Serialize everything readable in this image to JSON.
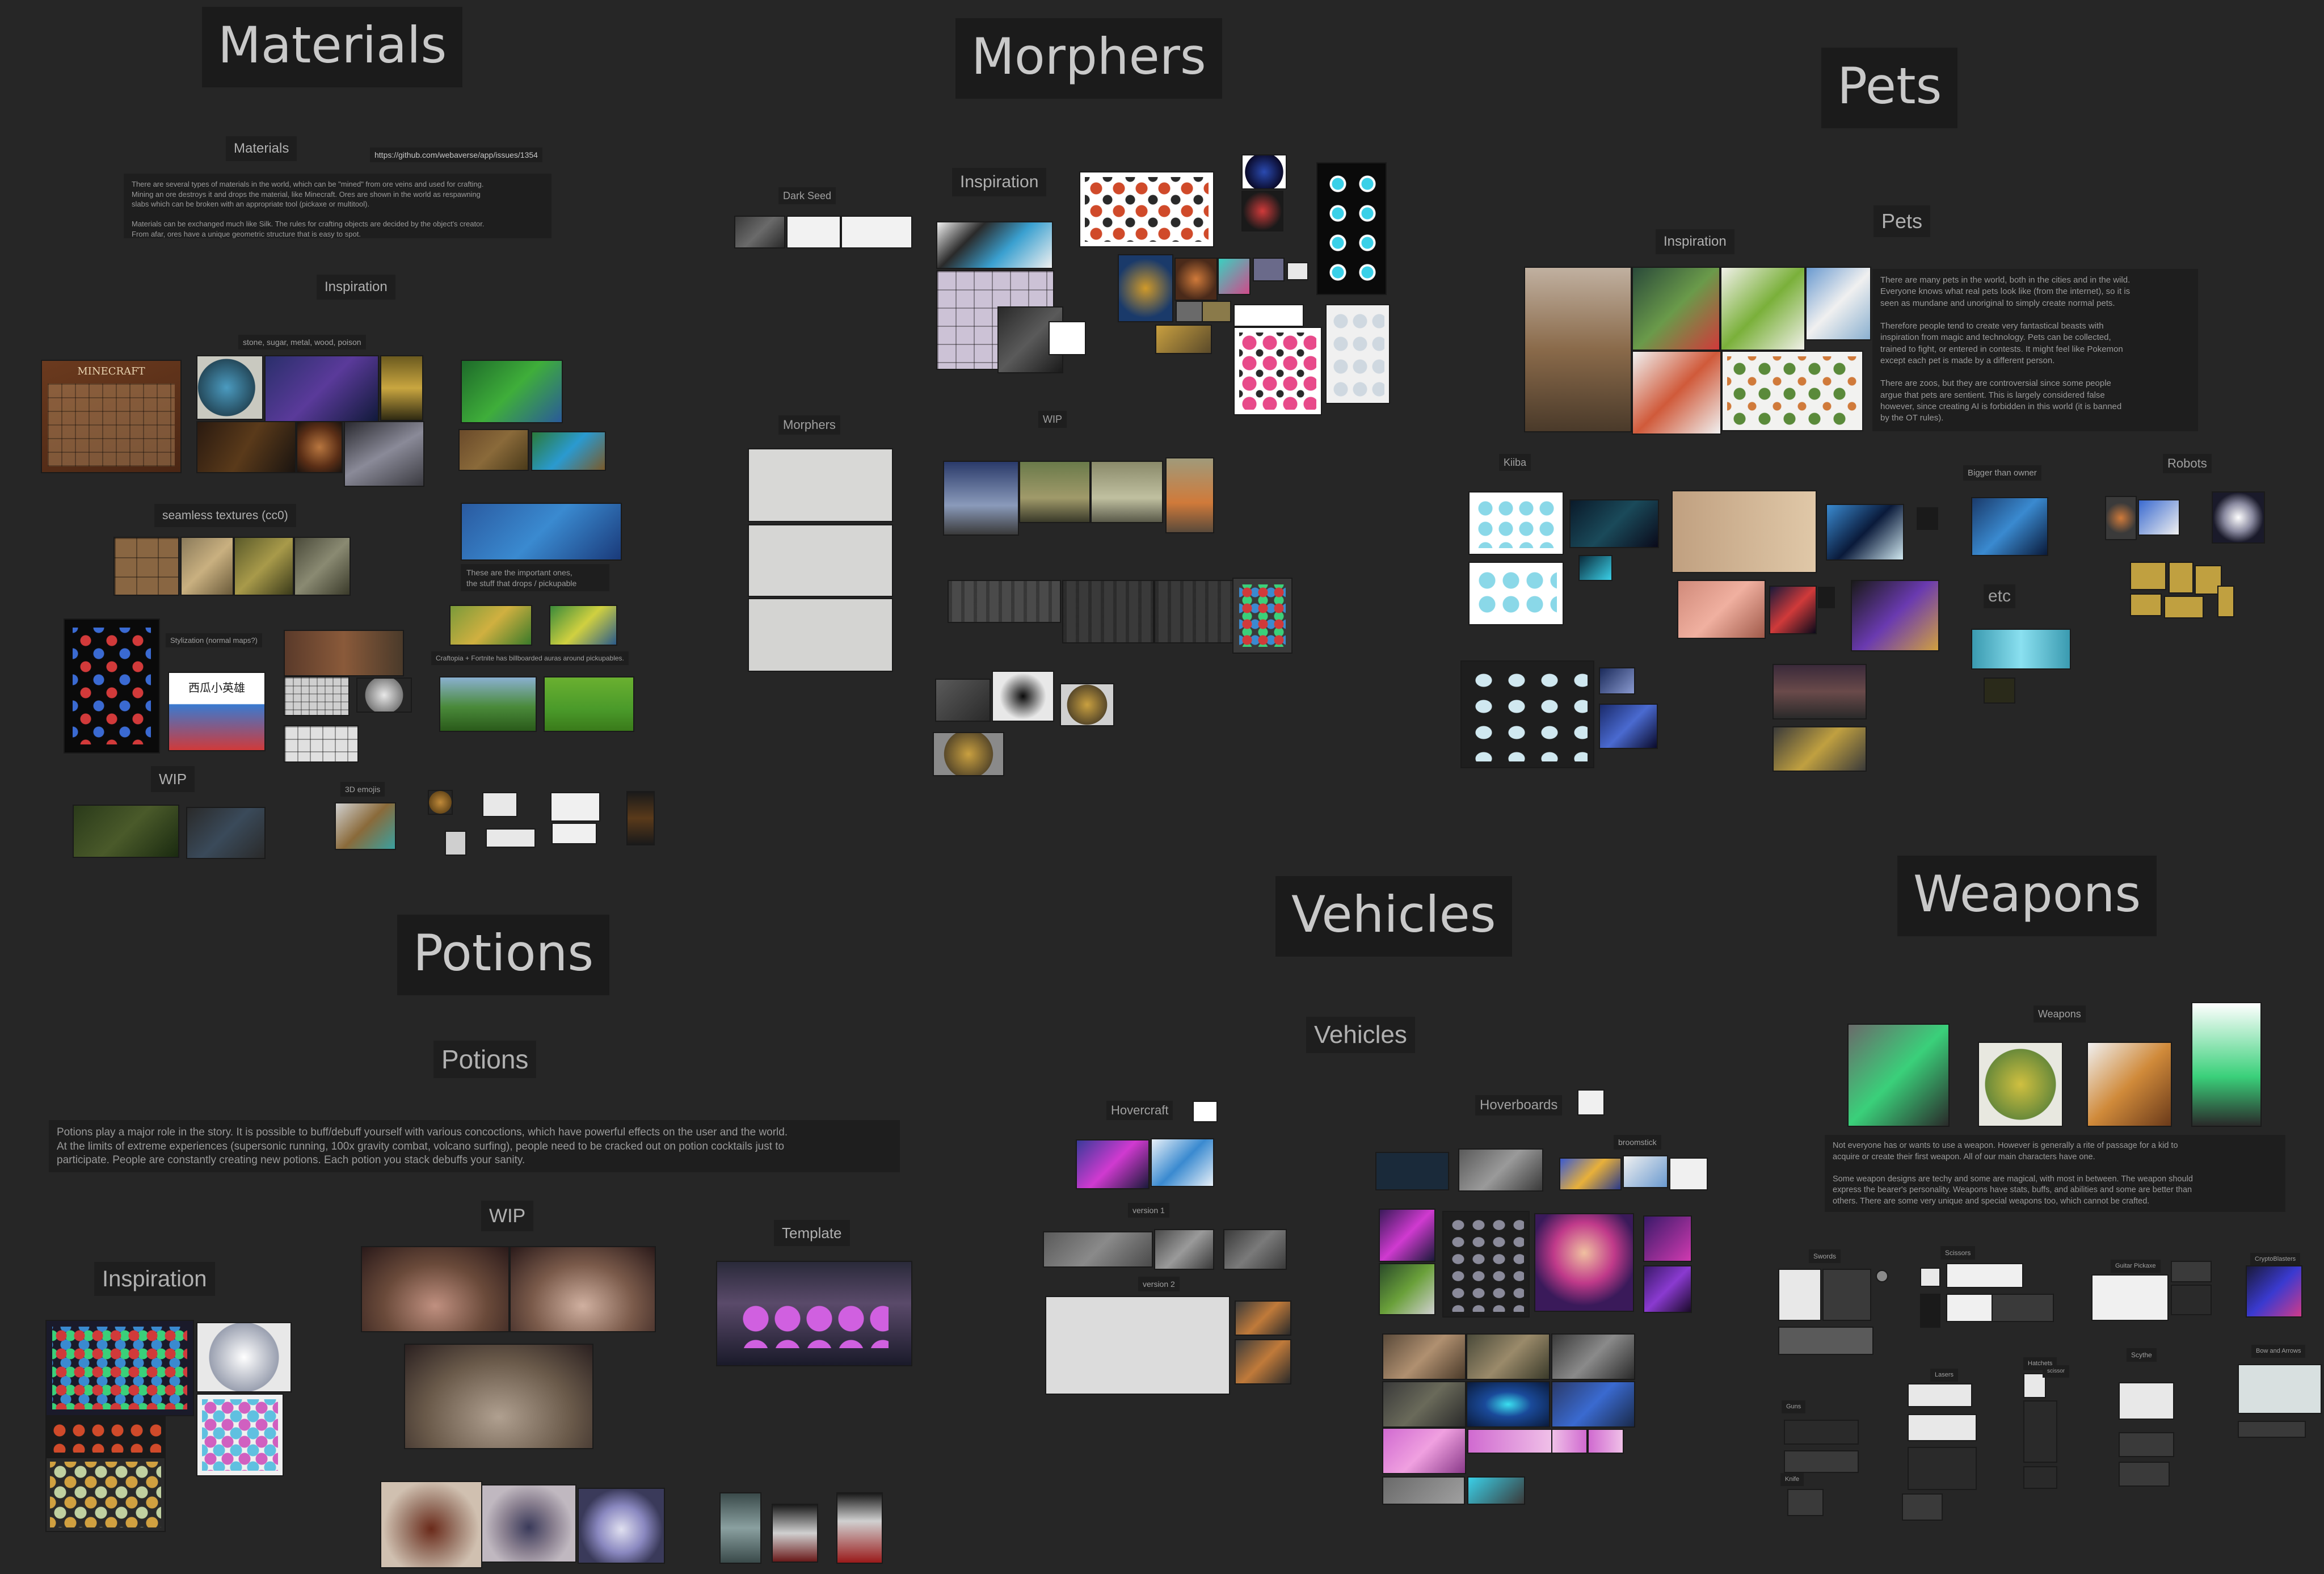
{
  "sections": {
    "materials": {
      "title": "Materials",
      "subtitle": "Materials",
      "link": "https://github.com/webaverse/app/issues/1354",
      "description": "There are several types of materials in the world, which can be \"mined\" from ore veins and used for crafting.\nMining an ore destroys it and drops the material, like Minecraft. Ores are shown in the world as respawning\nslabs which can be broken with an appropriate tool (pickaxe or multitool).\n\nMaterials can be exchanged much like Silk. The rules for crafting objects are decided by the object's creator.\nFrom afar, ores have a unique geometric structure that is easy to spot.",
      "inspiration": "Inspiration",
      "inspiration_caption": "stone, sugar, metal, wood, poison",
      "dark_seed": "Dark Seed",
      "seamless": "seamless textures (cc0)",
      "stylization": "Stylization (normal maps?)",
      "important": "These are the important ones,\nthe stuff that drops / pickupable",
      "craftopia": "Craftopia + Fortnite has billboarded auras around pickupables.",
      "wip": "WIP",
      "emojis": "3D emojis",
      "minecraft_caption": "MINECRAFT",
      "calligraphy": "西瓜小英雄"
    },
    "morphers": {
      "title": "Morphers",
      "inspiration": "Inspiration",
      "wip": "WIP",
      "morphers_label": "Morphers"
    },
    "pets": {
      "title": "Pets",
      "subtitle": "Pets",
      "inspiration": "Inspiration",
      "description": "There are many pets in the world, both in the cities and in the wild.\nEveryone knows what real pets look like (from the internet), so it is\nseen as mundane and unoriginal to simply create normal pets.\n\nTherefore people tend to create very fantastical beasts with\ninspiration from magic and technology. Pets can be collected,\ntrained to fight, or entered in contests. It might feel like Pokemon\nexcept each pet is made by a different person.\n\nThere are zoos, but they are controversial since some people\nargue that pets are sentient. This is largely considered false\nhowever, since creating AI is forbidden in this world (it is banned\nby the OT rules).",
      "kiiba": "Kiiba",
      "bigger": "Bigger than owner",
      "robots": "Robots",
      "etc": "etc"
    },
    "potions": {
      "title": "Potions",
      "subtitle": "Potions",
      "description": "Potions play a major role in the story. It is possible to buff/debuff yourself with various concoctions, which have powerful effects on the user and the world.\nAt the limits of extreme experiences (supersonic running, 100x gravity combat, volcano surfing), people need to be cracked out on potion cocktails just to\nparticipate. People are constantly creating new potions. Each potion you stack debuffs your sanity.",
      "wip": "WIP",
      "template": "Template",
      "inspiration": "Inspiration"
    },
    "vehicles": {
      "title": "Vehicles",
      "subtitle": "Vehicles",
      "hovercraft": "Hovercraft",
      "hoverboards": "Hoverboards",
      "broomstick": "broomstick",
      "version1": "version 1",
      "version2": "version 2"
    },
    "weapons": {
      "title": "Weapons",
      "subtitle": "Weapons",
      "description": "Not everyone has or wants to use a weapon. However is generally a rite of passage for a kid to\nacquire or create their first weapon. All of our main characters have one.\n\nSome weapon designs are techy and some are magical, with most in between. The weapon should\nexpress the bearer's personality. Weapons have stats, buffs, and abilities and some are better than\nothers. There are some very unique and special weapons too, which cannot be crafted.",
      "swords": "Swords",
      "scissors": "Scissors",
      "guitar_pickaxe": "Guitar Pickaxe",
      "cryptoblasters": "CryptoBlasters",
      "scythe": "Scythe",
      "bow_arrows": "Bow and Arrows",
      "lasers": "Lasers",
      "hatchets": "Hatchets",
      "guns": "Guns",
      "knife": "Knife",
      "scissor": "scissor"
    }
  },
  "colors": {
    "background": "#262626",
    "title_box": "#1b1b1b",
    "title_text": "#c9c9c9"
  }
}
